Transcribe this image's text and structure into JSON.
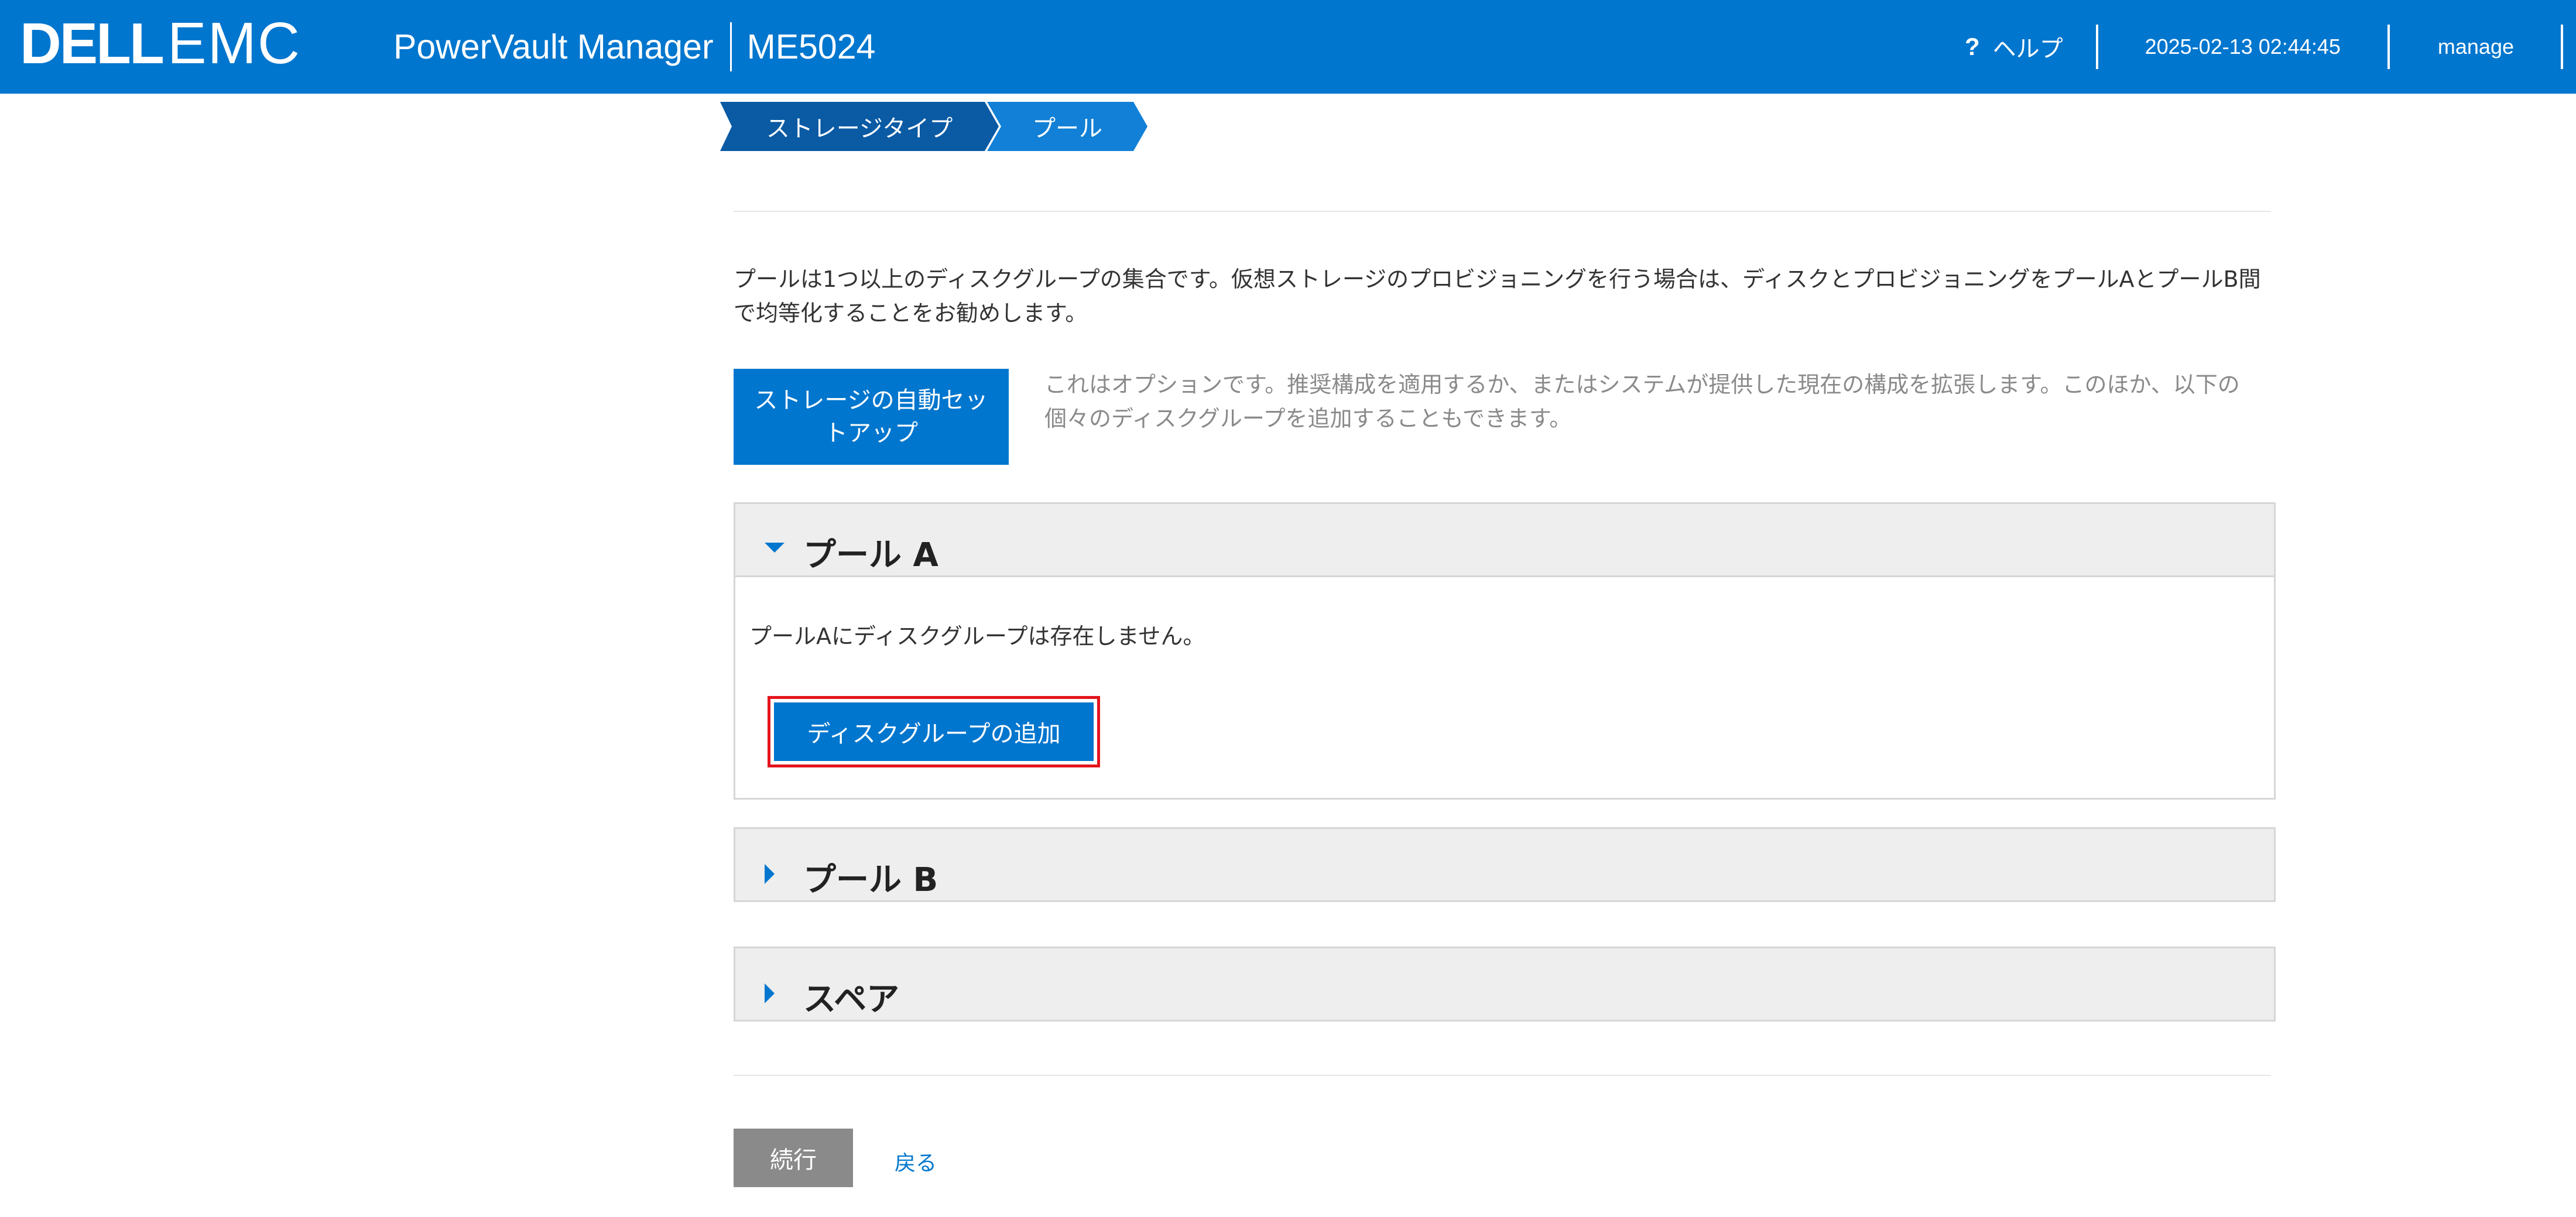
{
  "header": {
    "logo_dell": "DELL",
    "logo_emc": "EMC",
    "product_name": "PowerVault Manager",
    "system_name": "ME5024",
    "help_icon": "?",
    "help_label": "ヘルプ",
    "datetime": "2025-02-13 02:44:45",
    "user": "manage",
    "brand_color": "#0076ce"
  },
  "wizard": {
    "steps": [
      {
        "label": "ストレージタイプ"
      },
      {
        "label": "プール"
      }
    ]
  },
  "intro": {
    "text": "プールは1つ以上のディスクグループの集合です。仮想ストレージのプロビジョニングを行う場合は、ディスクとプロビジョニングをプールAとプールB間で均等化することをお勧めします。"
  },
  "auto_setup": {
    "button_label": "ストレージの自動セットアップ",
    "description": "これはオプションです。推奨構成を適用するか、またはシステムが提供した現在の構成を拡張します。このほか、以下の個々のディスクグループを追加することもできます。"
  },
  "pools": [
    {
      "title": "プール A",
      "expanded": true,
      "icon": "caret-down-icon",
      "empty_message": "プールAにディスクグループは存在しません。",
      "add_button_label": "ディスクグループの追加"
    },
    {
      "title": "プール B",
      "expanded": false,
      "icon": "caret-right-icon"
    },
    {
      "title": "スペア",
      "expanded": false,
      "icon": "caret-right-icon"
    }
  ],
  "footer": {
    "continue_label": "続行",
    "back_label": "戻る"
  },
  "colors": {
    "primary": "#0076ce",
    "step_active_dark": "#0a5aa4",
    "step_current": "#1280d6",
    "disabled_button": "#8a8a8a",
    "highlight_outline": "#e3141c",
    "panel_header_bg": "#eeeeee"
  }
}
